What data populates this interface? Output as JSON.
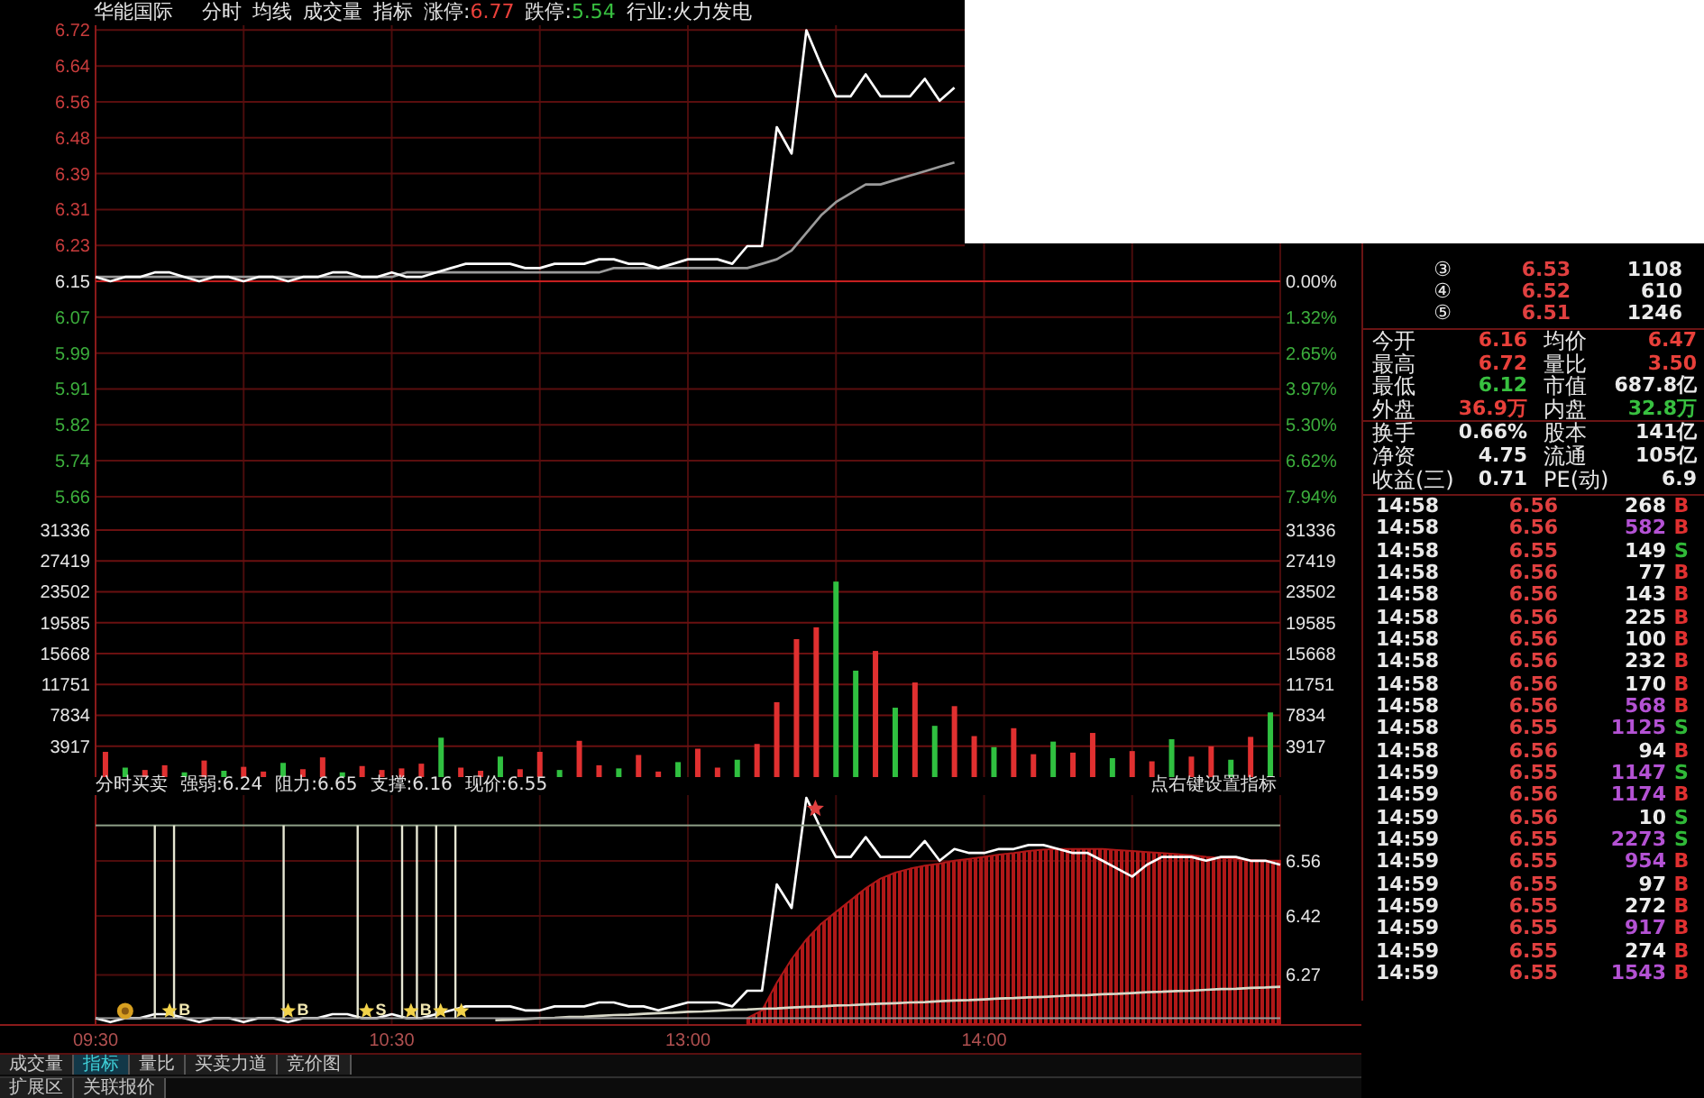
{
  "header": {
    "stock_name": "华能国际",
    "views": [
      {
        "label": "分时"
      },
      {
        "label": "均线"
      },
      {
        "label": "成交量"
      },
      {
        "label": "指标"
      }
    ],
    "limits": [
      {
        "label": "涨停:",
        "value": "6.77",
        "color": "#e8403a"
      },
      {
        "label": "跌停:",
        "value": "5.54",
        "color": "#38c040"
      }
    ],
    "industry": "行业:火力发电"
  },
  "price_chart": {
    "percent_labels": [
      "0.00%",
      "1.32%",
      "2.65%",
      "3.97%",
      "5.30%",
      "6.62%",
      "7.94%"
    ],
    "chart_data": {
      "type": "line",
      "grid": true,
      "ylim": [
        5.626,
        6.7315
      ],
      "yticks": [
        {
          "value": 6.7205,
          "label": "6.72"
        },
        {
          "value": 6.639,
          "label": "6.64"
        },
        {
          "value": 6.5575,
          "label": "6.56"
        },
        {
          "value": 6.476,
          "label": "6.48"
        },
        {
          "value": 6.3945,
          "label": "6.39"
        },
        {
          "value": 6.313,
          "label": "6.31"
        },
        {
          "value": 6.2315,
          "label": "6.23"
        },
        {
          "value": 6.15,
          "label": "6.15"
        },
        {
          "value": 6.0685,
          "label": "6.07"
        },
        {
          "value": 5.987,
          "label": "5.99"
        },
        {
          "value": 5.9055,
          "label": "5.91"
        },
        {
          "value": 5.824,
          "label": "5.82"
        },
        {
          "value": 5.7425,
          "label": "5.74"
        },
        {
          "value": 5.661,
          "label": "5.66"
        }
      ],
      "categories": [
        null,
        null,
        null,
        null,
        null,
        null,
        null,
        null,
        null,
        null,
        null,
        null,
        null,
        null,
        null,
        null,
        null,
        null,
        null,
        null,
        null,
        null,
        null,
        null,
        null,
        null,
        null,
        null,
        null,
        null,
        null,
        null,
        null,
        null,
        null,
        null,
        null,
        null,
        null,
        null,
        null,
        null,
        null,
        null,
        null,
        null,
        null,
        null,
        null,
        null,
        null,
        null,
        null,
        null,
        null,
        null,
        null,
        null,
        null,
        null,
        null,
        null,
        null,
        null,
        null,
        null,
        null,
        null,
        null,
        null,
        null,
        null,
        null,
        null,
        null,
        null,
        null,
        null,
        null,
        null,
        null
      ],
      "series": [
        {
          "color": "#ffffff",
          "values": [
            6.16,
            6.15,
            6.16,
            6.16,
            6.17,
            6.17,
            6.16,
            6.15,
            6.16,
            6.16,
            6.15,
            6.16,
            6.16,
            6.15,
            6.16,
            6.16,
            6.17,
            6.17,
            6.16,
            6.16,
            6.17,
            6.16,
            6.16,
            6.17,
            6.18,
            6.19,
            6.19,
            6.19,
            6.19,
            6.18,
            6.18,
            6.19,
            6.19,
            6.19,
            6.2,
            6.2,
            6.19,
            6.19,
            6.18,
            6.19,
            6.2,
            6.2,
            6.2,
            6.19,
            6.23,
            6.23,
            6.5,
            6.44,
            6.72,
            6.64,
            6.57,
            6.57,
            6.62,
            6.57,
            6.57,
            6.57,
            6.61,
            6.56,
            6.59,
            null,
            null,
            null,
            null,
            null,
            null,
            null,
            null,
            null,
            null,
            null,
            null,
            null,
            null,
            null,
            null,
            null,
            null,
            null,
            null,
            null,
            null
          ]
        },
        {
          "color": "#9a9a9a",
          "values": [
            6.16,
            6.16,
            6.16,
            6.16,
            6.16,
            6.16,
            6.16,
            6.16,
            6.16,
            6.16,
            6.16,
            6.16,
            6.16,
            6.16,
            6.16,
            6.16,
            6.16,
            6.16,
            6.16,
            6.16,
            6.16,
            6.17,
            6.17,
            6.17,
            6.17,
            6.17,
            6.17,
            6.17,
            6.17,
            6.17,
            6.17,
            6.17,
            6.17,
            6.17,
            6.17,
            6.18,
            6.18,
            6.18,
            6.18,
            6.18,
            6.18,
            6.18,
            6.18,
            6.18,
            6.18,
            6.19,
            6.2,
            6.22,
            6.26,
            6.3,
            6.33,
            6.35,
            6.37,
            6.37,
            6.38,
            6.39,
            6.4,
            6.41,
            6.42,
            null,
            null,
            null,
            null,
            null,
            null,
            null,
            null,
            null,
            null,
            null,
            null,
            null,
            null,
            null,
            null,
            null,
            null,
            null,
            null,
            null,
            null
          ]
        }
      ],
      "ref_lines": [
        {
          "axis": "y",
          "value": 6.15
        }
      ]
    }
  },
  "volume_chart": {
    "right_axis_labels": [
      "31336",
      "27419",
      "23502",
      "19585",
      "15668",
      "11751",
      "7834",
      "3917"
    ],
    "chart_data": {
      "type": "bar",
      "grid": true,
      "ylim": [
        0,
        33623
      ],
      "yticks": [
        {
          "value": 31336,
          "label": "31336"
        },
        {
          "value": 27419,
          "label": "27419"
        },
        {
          "value": 23502,
          "label": "23502"
        },
        {
          "value": 19585,
          "label": "19585"
        },
        {
          "value": 15668,
          "label": "15668"
        },
        {
          "value": 11751,
          "label": "11751"
        },
        {
          "value": 7834,
          "label": "7834"
        },
        {
          "value": 3917,
          "label": "3917"
        }
      ],
      "categories": [
        null,
        null,
        null,
        null,
        null,
        null,
        null,
        null,
        null,
        null,
        null,
        null,
        null,
        null,
        null,
        null,
        null,
        null,
        null,
        null,
        null,
        null,
        null,
        null,
        null,
        null,
        null,
        null,
        null,
        null,
        null,
        null,
        null,
        null,
        null,
        null,
        null,
        null,
        null,
        null,
        null,
        null,
        null,
        null,
        null,
        null,
        null,
        null,
        null,
        null,
        null,
        null,
        null,
        null,
        null,
        null,
        null,
        null,
        null,
        null
      ],
      "series": [
        {
          "color": "#e03030",
          "values": [
            3200,
            null,
            900,
            1500,
            null,
            2100,
            null,
            1300,
            700,
            null,
            1000,
            2500,
            null,
            1400,
            900,
            1100,
            1700,
            null,
            1200,
            800,
            null,
            1000,
            3200,
            null,
            4600,
            1500,
            null,
            2800,
            700,
            null,
            3600,
            1200,
            null,
            4200,
            9500,
            17500,
            19000,
            null,
            null,
            16000,
            null,
            12000,
            null,
            9000,
            5200,
            null,
            6200,
            2900,
            null,
            3100,
            5600,
            null,
            3300,
            2000,
            null,
            2600,
            3900,
            null,
            5100,
            null
          ]
        },
        {
          "color": "#30c040",
          "values": [
            null,
            1200,
            null,
            null,
            600,
            null,
            800,
            null,
            null,
            1800,
            null,
            null,
            600,
            null,
            null,
            null,
            null,
            5000,
            null,
            null,
            2600,
            null,
            null,
            900,
            null,
            null,
            1100,
            null,
            null,
            1900,
            null,
            null,
            2200,
            null,
            null,
            null,
            null,
            24800,
            13500,
            null,
            8800,
            null,
            6500,
            null,
            null,
            3800,
            null,
            null,
            4500,
            null,
            null,
            2400,
            null,
            null,
            4800,
            null,
            null,
            2200,
            null,
            8200
          ]
        }
      ]
    }
  },
  "indicator": {
    "title": "分时买卖",
    "readings": [
      "强弱:6.24",
      "阻力:6.65",
      "支撑:6.16",
      "现价:6.55"
    ],
    "hint": "点右键设置指标",
    "signals": [
      {
        "kind": "coin"
      },
      {
        "kind": "star",
        "label": "B"
      },
      {
        "kind": "star",
        "label": "B"
      },
      {
        "kind": "star",
        "label": "S"
      },
      {
        "kind": "star",
        "label": "B"
      },
      {
        "kind": "star"
      },
      {
        "kind": "star"
      }
    ],
    "chart_data": {
      "type": "line",
      "grid": true,
      "ylim": [
        6.145,
        6.727
      ],
      "yticks": [
        6.56,
        6.42,
        6.27
      ],
      "categories": [
        "09:30",
        null,
        null,
        null,
        null,
        null,
        null,
        null,
        null,
        null,
        null,
        null,
        null,
        null,
        null,
        null,
        null,
        null,
        null,
        null,
        "10:30",
        null,
        null,
        null,
        null,
        null,
        null,
        null,
        null,
        null,
        null,
        null,
        null,
        null,
        null,
        null,
        null,
        null,
        null,
        null,
        "13:00",
        null,
        null,
        null,
        null,
        null,
        null,
        null,
        null,
        null,
        null,
        null,
        null,
        null,
        null,
        null,
        null,
        null,
        null,
        null,
        "14:00",
        null,
        null,
        null,
        null,
        null,
        null,
        null,
        null,
        null,
        null,
        null,
        null,
        null,
        null,
        null,
        null,
        null,
        null,
        null,
        null
      ],
      "series": [
        {
          "type": "area",
          "color": "#b01818",
          "values": [
            null,
            null,
            null,
            null,
            null,
            null,
            null,
            null,
            null,
            null,
            null,
            null,
            null,
            null,
            null,
            null,
            null,
            null,
            null,
            null,
            null,
            null,
            null,
            null,
            null,
            null,
            null,
            null,
            null,
            null,
            null,
            null,
            null,
            null,
            null,
            null,
            null,
            null,
            null,
            null,
            null,
            null,
            null,
            null,
            6.16,
            6.18,
            6.25,
            6.31,
            6.36,
            6.4,
            6.43,
            6.46,
            6.49,
            6.515,
            6.53,
            6.54,
            6.548,
            6.553,
            6.56,
            6.565,
            6.57,
            6.576,
            6.58,
            6.585,
            6.588,
            6.59,
            6.59,
            6.59,
            6.59,
            6.587,
            6.585,
            6.582,
            6.58,
            6.577,
            6.574,
            6.57,
            6.567,
            6.565,
            6.562,
            6.56,
            6.56
          ]
        },
        {
          "color": "#ffffff",
          "values": [
            6.16,
            6.15,
            6.16,
            6.16,
            6.17,
            6.17,
            6.16,
            6.15,
            6.16,
            6.16,
            6.15,
            6.16,
            6.16,
            6.15,
            6.16,
            6.16,
            6.17,
            6.17,
            6.16,
            6.16,
            6.17,
            6.16,
            6.16,
            6.17,
            6.18,
            6.19,
            6.19,
            6.19,
            6.19,
            6.18,
            6.18,
            6.19,
            6.19,
            6.19,
            6.2,
            6.2,
            6.19,
            6.19,
            6.18,
            6.19,
            6.2,
            6.2,
            6.2,
            6.19,
            6.23,
            6.23,
            6.5,
            6.44,
            6.72,
            6.64,
            6.57,
            6.57,
            6.62,
            6.57,
            6.57,
            6.57,
            6.61,
            6.56,
            6.59,
            6.58,
            6.58,
            6.59,
            6.59,
            6.6,
            6.6,
            6.59,
            6.58,
            6.58,
            6.56,
            6.54,
            6.52,
            6.55,
            6.57,
            6.57,
            6.57,
            6.56,
            6.57,
            6.57,
            6.56,
            6.56,
            6.55
          ]
        },
        {
          "color": "#d8d8c8",
          "values": [
            null,
            null,
            null,
            null,
            null,
            null,
            null,
            null,
            null,
            null,
            null,
            null,
            null,
            null,
            null,
            null,
            null,
            null,
            null,
            null,
            null,
            null,
            null,
            null,
            null,
            null,
            null,
            6.155,
            6.156,
            6.158,
            6.16,
            6.161,
            6.163,
            6.164,
            6.166,
            6.168,
            6.169,
            6.171,
            6.173,
            6.174,
            6.176,
            6.177,
            6.179,
            6.181,
            6.182,
            6.184,
            6.185,
            6.187,
            6.189,
            6.19,
            6.192,
            6.193,
            6.195,
            6.197,
            6.198,
            6.2,
            6.201,
            6.203,
            6.205,
            6.206,
            6.208,
            6.21,
            6.211,
            6.213,
            6.214,
            6.216,
            6.218,
            6.219,
            6.221,
            6.222,
            6.224,
            6.226,
            6.227,
            6.229,
            6.23,
            6.232,
            6.234,
            6.235,
            6.237,
            6.238,
            6.24
          ]
        }
      ],
      "ref_lines": [
        {
          "axis": "y",
          "value": 6.65
        },
        {
          "axis": "y",
          "value": 6.16
        }
      ]
    }
  },
  "tabs": [
    {
      "label": "成交量",
      "selected": false
    },
    {
      "label": "指标",
      "selected": true
    },
    {
      "label": "量比",
      "selected": false
    },
    {
      "label": "买卖力道",
      "selected": false
    },
    {
      "label": "竞价图",
      "selected": false
    }
  ],
  "sub_tabs": [
    {
      "label": "扩展区",
      "selected": false
    },
    {
      "label": "关联报价",
      "selected": false
    }
  ],
  "order_book": [
    {
      "rank": "③",
      "price": "6.53",
      "volume": "1108"
    },
    {
      "rank": "④",
      "price": "6.52",
      "volume": "610"
    },
    {
      "rank": "⑤",
      "price": "6.51",
      "volume": "1246"
    }
  ],
  "stats": [
    {
      "items": [
        {
          "label": "今开",
          "value": "6.16",
          "color": "#e8403a"
        },
        {
          "label": "均价",
          "value": "6.47",
          "color": "#e8403a"
        },
        {
          "label": "最高",
          "value": "6.72",
          "color": "#e8403a"
        },
        {
          "label": "量比",
          "value": "3.50",
          "color": "#e8403a"
        },
        {
          "label": "最低",
          "value": "6.12",
          "color": "#38c040"
        },
        {
          "label": "市值",
          "value": "687.8亿",
          "color": "#eaeaea"
        },
        {
          "label": "外盘",
          "value": "36.9万",
          "color": "#e8403a"
        },
        {
          "label": "内盘",
          "value": "32.8万",
          "color": "#38c040"
        }
      ]
    },
    {
      "items": [
        {
          "label": "换手",
          "value": "0.66%",
          "color": "#eaeaea"
        },
        {
          "label": "股本",
          "value": "141亿",
          "color": "#eaeaea"
        },
        {
          "label": "净资",
          "value": "4.75",
          "color": "#eaeaea"
        },
        {
          "label": "流通",
          "value": "105亿",
          "color": "#eaeaea"
        },
        {
          "label": "收益(三)",
          "value": "0.71",
          "color": "#eaeaea"
        },
        {
          "label": "PE(动)",
          "value": "6.9",
          "color": "#eaeaea"
        }
      ]
    }
  ],
  "ticks": [
    {
      "time": "14:58",
      "price": "6.56",
      "volume": "268",
      "side": "B",
      "kind": "buy",
      "large": false
    },
    {
      "time": "14:58",
      "price": "6.56",
      "volume": "582",
      "side": "B",
      "kind": "buy",
      "large": true
    },
    {
      "time": "14:58",
      "price": "6.55",
      "volume": "149",
      "side": "S",
      "kind": "sell",
      "large": false
    },
    {
      "time": "14:58",
      "price": "6.56",
      "volume": "77",
      "side": "B",
      "kind": "buy",
      "large": false
    },
    {
      "time": "14:58",
      "price": "6.56",
      "volume": "143",
      "side": "B",
      "kind": "buy",
      "large": false
    },
    {
      "time": "14:58",
      "price": "6.56",
      "volume": "225",
      "side": "B",
      "kind": "buy",
      "large": false
    },
    {
      "time": "14:58",
      "price": "6.56",
      "volume": "100",
      "side": "B",
      "kind": "buy",
      "large": false
    },
    {
      "time": "14:58",
      "price": "6.56",
      "volume": "232",
      "side": "B",
      "kind": "buy",
      "large": false
    },
    {
      "time": "14:58",
      "price": "6.56",
      "volume": "170",
      "side": "B",
      "kind": "buy",
      "large": false
    },
    {
      "time": "14:58",
      "price": "6.56",
      "volume": "568",
      "side": "B",
      "kind": "buy",
      "large": true
    },
    {
      "time": "14:58",
      "price": "6.55",
      "volume": "1125",
      "side": "S",
      "kind": "sell",
      "large": true
    },
    {
      "time": "14:58",
      "price": "6.56",
      "volume": "94",
      "side": "B",
      "kind": "buy",
      "large": false
    },
    {
      "time": "14:59",
      "price": "6.55",
      "volume": "1147",
      "side": "S",
      "kind": "sell",
      "large": true
    },
    {
      "time": "14:59",
      "price": "6.56",
      "volume": "1174",
      "side": "B",
      "kind": "buy",
      "large": true
    },
    {
      "time": "14:59",
      "price": "6.56",
      "volume": "10",
      "side": "S",
      "kind": "sell",
      "large": false
    },
    {
      "time": "14:59",
      "price": "6.55",
      "volume": "2273",
      "side": "S",
      "kind": "sell",
      "large": true
    },
    {
      "time": "14:59",
      "price": "6.55",
      "volume": "954",
      "side": "B",
      "kind": "buy",
      "large": true
    },
    {
      "time": "14:59",
      "price": "6.55",
      "volume": "97",
      "side": "B",
      "kind": "buy",
      "large": false
    },
    {
      "time": "14:59",
      "price": "6.55",
      "volume": "272",
      "side": "B",
      "kind": "buy",
      "large": false
    },
    {
      "time": "14:59",
      "price": "6.55",
      "volume": "917",
      "side": "B",
      "kind": "buy",
      "large": true
    },
    {
      "time": "14:59",
      "price": "6.55",
      "volume": "274",
      "side": "B",
      "kind": "buy",
      "large": false
    },
    {
      "time": "14:59",
      "price": "6.55",
      "volume": "1543",
      "side": "B",
      "kind": "buy",
      "large": true
    }
  ]
}
